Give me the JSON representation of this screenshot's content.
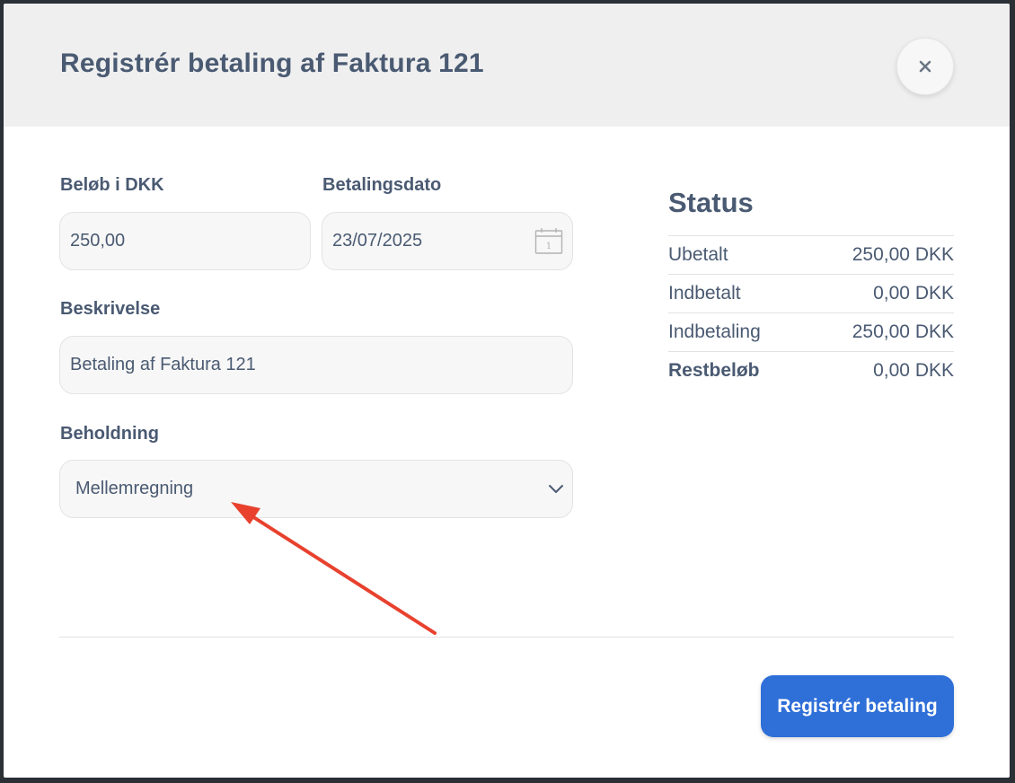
{
  "modal": {
    "title": "Registrér betaling af Faktura 121",
    "close_icon": "close-icon",
    "close_symbol": "×"
  },
  "form": {
    "amount": {
      "label": "Beløb i DKK",
      "value": "250,00"
    },
    "date": {
      "label": "Betalingsdato",
      "value": "23/07/2025",
      "icon": "calendar-icon",
      "calendar_day": "1"
    },
    "description": {
      "label": "Beskrivelse",
      "value": "Betaling af Faktura 121"
    },
    "account": {
      "label": "Beholdning",
      "selected": "Mellemregning",
      "icon": "chevron-down-icon"
    }
  },
  "status": {
    "title": "Status",
    "rows": [
      {
        "label": "Ubetalt",
        "value": "250,00 DKK"
      },
      {
        "label": "Indbetalt",
        "value": "0,00 DKK"
      },
      {
        "label": "Indbetaling",
        "value": "250,00 DKK"
      },
      {
        "label": "Restbeløb",
        "value": "0,00 DKK"
      }
    ]
  },
  "footer": {
    "submit_label": "Registrér betaling"
  },
  "colors": {
    "primary": "#2f6fd8",
    "text": "#4a5a72",
    "annotation_arrow": "#e8412e",
    "header_bg": "#efefef"
  }
}
